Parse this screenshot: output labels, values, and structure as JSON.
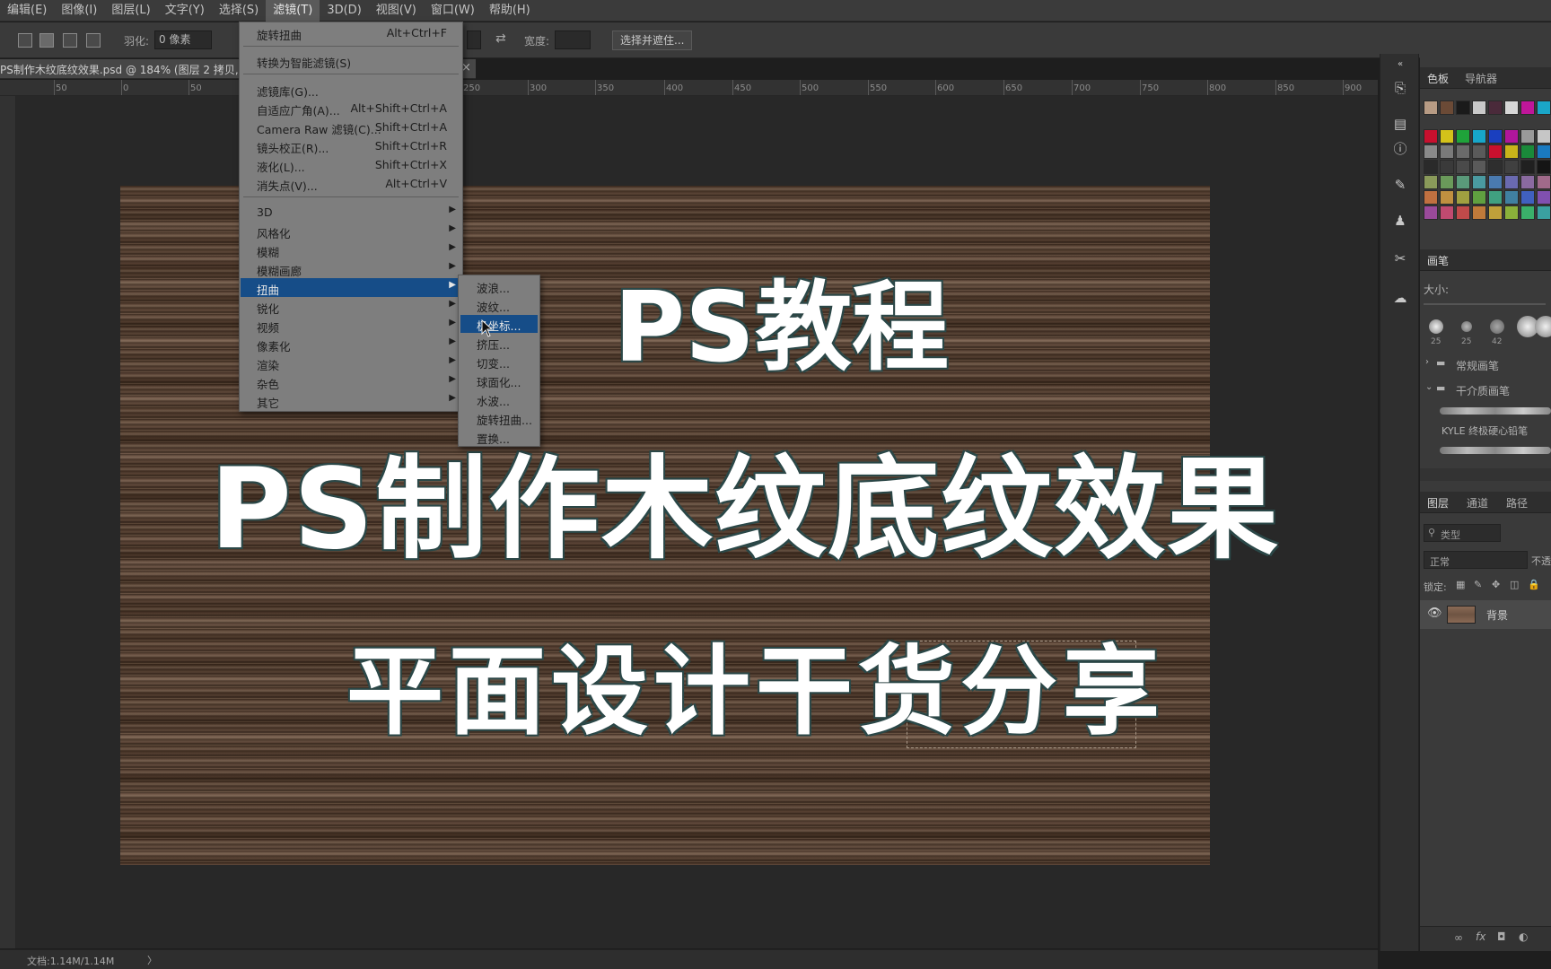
{
  "menubar": {
    "items": [
      "编辑(E)",
      "图像(I)",
      "图层(L)",
      "文字(Y)",
      "选择(S)",
      "滤镜(T)",
      "3D(D)",
      "视图(V)",
      "窗口(W)",
      "帮助(H)"
    ],
    "active_index": 5
  },
  "options": {
    "feather_label": "羽化:",
    "feather_value": "0 像素",
    "width_label": "宽度:",
    "select_mask_button": "选择并遮住..."
  },
  "document_tab": {
    "title": "PS制作木纹底纹效果.psd @ 184% (图层 2 拷贝,",
    "close": "×"
  },
  "ruler": {
    "ticks": [
      "50",
      "0",
      "50",
      "250",
      "300",
      "350",
      "400",
      "450",
      "500",
      "550",
      "600",
      "650",
      "700",
      "750",
      "800",
      "850",
      "900"
    ]
  },
  "filter_menu": {
    "top_items": [
      {
        "label": "旋转扭曲",
        "shortcut": "Alt+Ctrl+F"
      },
      {
        "label": "转换为智能滤镜(S)",
        "shortcut": ""
      },
      {
        "label": "滤镜库(G)...",
        "shortcut": ""
      },
      {
        "label": "自适应广角(A)...",
        "shortcut": "Alt+Shift+Ctrl+A"
      },
      {
        "label": "Camera Raw 滤镜(C)...",
        "shortcut": "Shift+Ctrl+A"
      },
      {
        "label": "镜头校正(R)...",
        "shortcut": "Shift+Ctrl+R"
      },
      {
        "label": "液化(L)...",
        "shortcut": "Shift+Ctrl+X"
      },
      {
        "label": "消失点(V)...",
        "shortcut": "Alt+Ctrl+V"
      }
    ],
    "submenu_items": [
      "3D",
      "风格化",
      "模糊",
      "模糊画廊",
      "扭曲",
      "锐化",
      "视频",
      "像素化",
      "渲染",
      "杂色",
      "其它"
    ],
    "highlighted": "扭曲",
    "arrow": "▶"
  },
  "distort_submenu": {
    "items": [
      "波浪...",
      "波纹...",
      "极坐标...",
      "挤压...",
      "切变...",
      "球面化...",
      "水波...",
      "旋转扭曲...",
      "置换..."
    ],
    "highlighted_index": 2
  },
  "canvas_text": {
    "line1": "PS教程",
    "line2": "PS制作木纹底纹效果",
    "line3": "平面设计干货分享"
  },
  "panels": {
    "swatches_tab": "色板",
    "navigator_tab": "导航器",
    "brush_tab": "画笔",
    "brush_size_label": "大小:",
    "brush_sizes": [
      "25",
      "25",
      "42"
    ],
    "group1": "常规画笔",
    "group2": "干介质画笔",
    "brush_preset": "KYLE 终极硬心铅笔",
    "layers_tab": "图层",
    "channels_tab": "通道",
    "paths_tab": "路径",
    "kind_label": "类型",
    "blend_mode": "正常",
    "opacity_label": "不透",
    "lock_label": "锁定:",
    "layer_name": "背景",
    "swatch_colors_row0": [
      "#b79b84",
      "#6b4a36",
      "#1a1a1a",
      "#c9c9c9",
      "#4a2a3a",
      "#d6d6d6",
      "#c0169a",
      "#1aa6c8"
    ],
    "swatch_colors": [
      [
        "#c8102e",
        "#d4c21a",
        "#1fa33a",
        "#17a6c9",
        "#1a3fbf",
        "#b0169c",
        "#9a9a9a",
        "#c6c6c6"
      ],
      [
        "#8a8a8a",
        "#7a7a7a",
        "#6a6a6a",
        "#5a5a5a",
        "#c8102e",
        "#c8b41a",
        "#1a8a3a",
        "#1a7ac0"
      ],
      [
        "#2a2a2a",
        "#3a3a3a",
        "#4a4a4a",
        "#5a5a5a",
        "#2e2e2e",
        "#404040",
        "#202020",
        "#151515"
      ],
      [
        "#8a9a5a",
        "#6a9a5a",
        "#5a9a7a",
        "#4a9aa0",
        "#4a7ab0",
        "#6a6ab0",
        "#8a6aa0",
        "#a06a8a"
      ],
      [
        "#c07040",
        "#c09040",
        "#a0a040",
        "#60a040",
        "#40a080",
        "#4080a0",
        "#4060c0",
        "#8050b0"
      ],
      [
        "#9a4a9a",
        "#c04a70",
        "#c04a4a",
        "#c07a3a",
        "#c0a03a",
        "#8ab03a",
        "#3ab06a",
        "#3aa0a0"
      ]
    ]
  },
  "status": {
    "doc_info": "文档:1.14M/1.14M",
    "arrow": "〉"
  }
}
